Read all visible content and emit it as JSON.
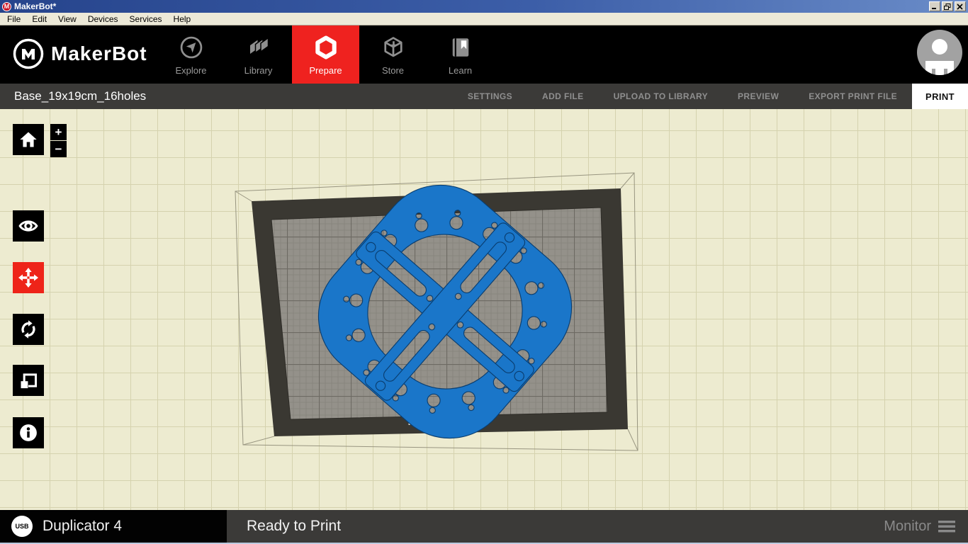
{
  "window": {
    "title": "MakerBot*"
  },
  "menubar": {
    "items": [
      "File",
      "Edit",
      "View",
      "Devices",
      "Services",
      "Help"
    ]
  },
  "header": {
    "brand": "MakerBot",
    "nav": [
      {
        "label": "Explore",
        "active": false
      },
      {
        "label": "Library",
        "active": false
      },
      {
        "label": "Prepare",
        "active": true
      },
      {
        "label": "Store",
        "active": false
      },
      {
        "label": "Learn",
        "active": false
      }
    ]
  },
  "subheader": {
    "filename": "Base_19x19cm_16holes",
    "actions": [
      {
        "label": "SETTINGS"
      },
      {
        "label": "ADD FILE"
      },
      {
        "label": "UPLOAD TO LIBRARY"
      },
      {
        "label": "PREVIEW"
      },
      {
        "label": "EXPORT PRINT FILE"
      }
    ],
    "print_label": "PRINT"
  },
  "toolbar": {
    "zoom_in": "+",
    "zoom_out": "−",
    "tools": [
      "home",
      "view",
      "move",
      "rotate",
      "scale",
      "info"
    ],
    "active_tool": "move"
  },
  "viewport": {
    "bed_brand": "MakerBot"
  },
  "statusbar": {
    "connection": "USB",
    "device": "Duplicator 4",
    "status": "Ready to Print",
    "monitor_label": "Monitor"
  },
  "colors": {
    "accent_red": "#ee2419",
    "model_blue": "#1a76c9",
    "model_edge": "#0a3e70",
    "bed_frame": "#3a3832",
    "bed_surface": "#94918a",
    "viewport_bg": "#edebd0"
  }
}
